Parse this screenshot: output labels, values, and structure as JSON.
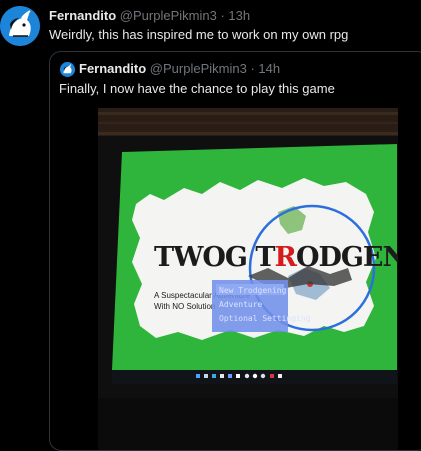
{
  "tweet": {
    "author_name": "Fernandito",
    "author_handle": "@PurplePikmin3",
    "separator": "·",
    "time": "13h",
    "text": "Weirdly, this has inspired me to work on my own rpg",
    "avatar_icon": "unicorn-avatar-icon"
  },
  "quoted_tweet": {
    "author_name": "Fernandito",
    "author_handle": "@PurplePikmin3",
    "separator": "·",
    "time": "14h",
    "text": "Finally, I now have the chance to play this game",
    "media": {
      "game_title_part1": "TWOG T",
      "game_title_red": "R",
      "game_title_part2": "ODGENING",
      "subtitle_line1": "A Suspectacular Adventure",
      "subtitle_line2": "With NO Solution",
      "menu_items": [
        "New Trodgening",
        "Adventure",
        "Optional Settinging"
      ],
      "colors": {
        "screen_green": "#2fb53b",
        "paper": "#f4f4f2",
        "circle_blue": "#2c6fdc",
        "menu_blue": "#6f8fe8",
        "title_red": "#d51b1b"
      }
    }
  }
}
